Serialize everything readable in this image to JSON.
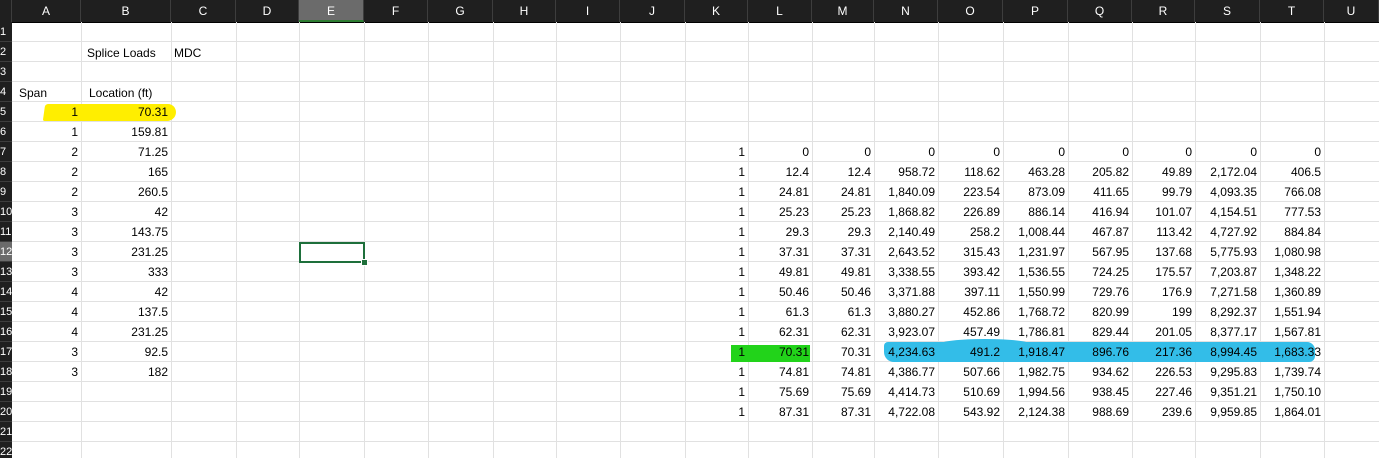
{
  "columns": [
    "A",
    "B",
    "C",
    "D",
    "E",
    "F",
    "G",
    "H",
    "I",
    "J",
    "K",
    "L",
    "M",
    "N",
    "O",
    "P",
    "Q",
    "R",
    "S",
    "T",
    "U"
  ],
  "selected_column": "E",
  "rows": [
    "1",
    "2",
    "3",
    "4",
    "5",
    "6",
    "7",
    "8",
    "9",
    "10",
    "11",
    "12",
    "13",
    "14",
    "15",
    "16",
    "17",
    "18",
    "19",
    "20",
    "21",
    "22"
  ],
  "selected_row": "12",
  "header_cells": {
    "b2": "Splice Loads",
    "c2": "MDC",
    "a4": "Span",
    "b4": "Location (ft)"
  },
  "left_table": [
    {
      "span": "1",
      "loc": "70.31"
    },
    {
      "span": "1",
      "loc": "159.81"
    },
    {
      "span": "2",
      "loc": "71.25"
    },
    {
      "span": "2",
      "loc": "165"
    },
    {
      "span": "2",
      "loc": "260.5"
    },
    {
      "span": "3",
      "loc": "42"
    },
    {
      "span": "3",
      "loc": "143.75"
    },
    {
      "span": "3",
      "loc": "231.25"
    },
    {
      "span": "3",
      "loc": "333"
    },
    {
      "span": "4",
      "loc": "42"
    },
    {
      "span": "4",
      "loc": "137.5"
    },
    {
      "span": "4",
      "loc": "231.25"
    },
    {
      "span": "3",
      "loc": "92.5"
    },
    {
      "span": "3",
      "loc": "182"
    }
  ],
  "right_table": [
    [
      "1",
      "0",
      "0",
      "0",
      "0",
      "0",
      "0",
      "0",
      "0",
      "0"
    ],
    [
      "1",
      "12.4",
      "12.4",
      "958.72",
      "118.62",
      "463.28",
      "205.82",
      "49.89",
      "2,172.04",
      "406.5"
    ],
    [
      "1",
      "24.81",
      "24.81",
      "1,840.09",
      "223.54",
      "873.09",
      "411.65",
      "99.79",
      "4,093.35",
      "766.08"
    ],
    [
      "1",
      "25.23",
      "25.23",
      "1,868.82",
      "226.89",
      "886.14",
      "416.94",
      "101.07",
      "4,154.51",
      "777.53"
    ],
    [
      "1",
      "29.3",
      "29.3",
      "2,140.49",
      "258.2",
      "1,008.44",
      "467.87",
      "113.42",
      "4,727.92",
      "884.84"
    ],
    [
      "1",
      "37.31",
      "37.31",
      "2,643.52",
      "315.43",
      "1,231.97",
      "567.95",
      "137.68",
      "5,775.93",
      "1,080.98"
    ],
    [
      "1",
      "49.81",
      "49.81",
      "3,338.55",
      "393.42",
      "1,536.55",
      "724.25",
      "175.57",
      "7,203.87",
      "1,348.22"
    ],
    [
      "1",
      "50.46",
      "50.46",
      "3,371.88",
      "397.11",
      "1,550.99",
      "729.76",
      "176.9",
      "7,271.58",
      "1,360.89"
    ],
    [
      "1",
      "61.3",
      "61.3",
      "3,880.27",
      "452.86",
      "1,768.72",
      "820.99",
      "199",
      "8,292.37",
      "1,551.94"
    ],
    [
      "1",
      "62.31",
      "62.31",
      "3,923.07",
      "457.49",
      "1,786.81",
      "829.44",
      "201.05",
      "8,377.17",
      "1,567.81"
    ],
    [
      "1",
      "70.31",
      "70.31",
      "4,234.63",
      "491.2",
      "1,918.47",
      "896.76",
      "217.36",
      "8,994.45",
      "1,683.33"
    ],
    [
      "1",
      "74.81",
      "74.81",
      "4,386.77",
      "507.66",
      "1,982.75",
      "934.62",
      "226.53",
      "9,295.83",
      "1,739.74"
    ],
    [
      "1",
      "75.69",
      "75.69",
      "4,414.73",
      "510.69",
      "1,994.56",
      "938.45",
      "227.46",
      "9,351.21",
      "1,750.10"
    ],
    [
      "1",
      "87.31",
      "87.31",
      "4,722.08",
      "543.92",
      "2,124.38",
      "988.69",
      "239.6",
      "9,959.85",
      "1,864.01"
    ]
  ],
  "highlight_colors": {
    "yellow": "#ffee00",
    "green": "#22d31a",
    "blue": "#33bde8",
    "selection": "#1e6f3b"
  }
}
